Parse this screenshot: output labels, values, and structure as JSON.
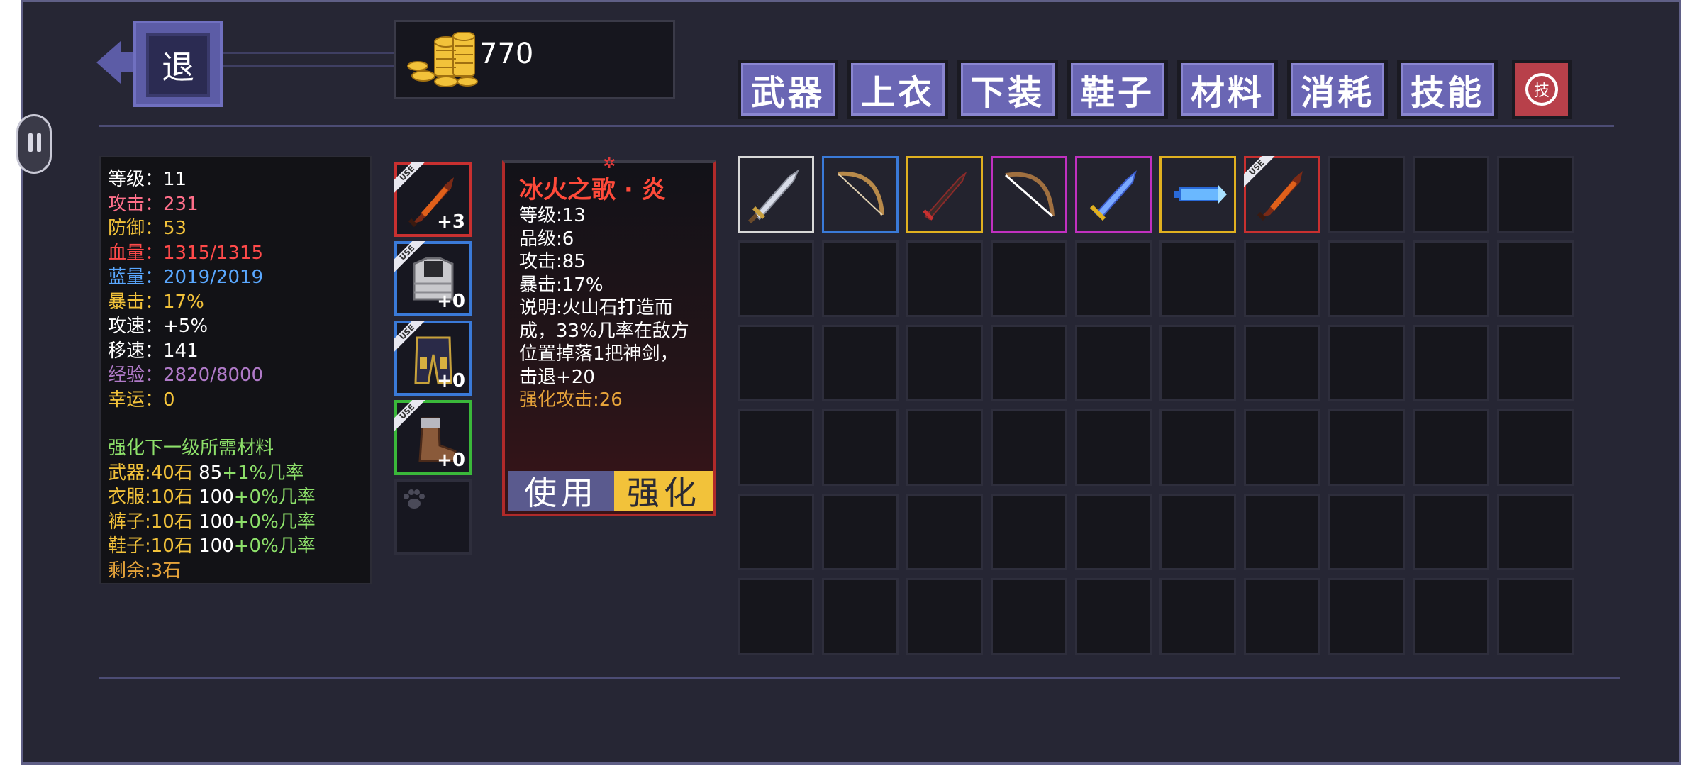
{
  "header": {
    "back_label": "退",
    "gold_value": "770"
  },
  "tabs": [
    "武器",
    "上衣",
    "下装",
    "鞋子",
    "材料",
    "消耗",
    "技能"
  ],
  "skill_tab_label": "技",
  "stats": {
    "level": "等级：11",
    "attack": "攻击：231",
    "defense": "防御：53",
    "hp": "血量：1315/1315",
    "mp": "蓝量：2019/2019",
    "crit": "暴击：17%",
    "atk_speed": "攻速：+5%",
    "move_speed": "移速：141",
    "exp": "经验：2820/8000",
    "luck": "幸运：0"
  },
  "upgrade": {
    "heading": "强化下一级所需材料",
    "weapon_label": "武器:40石",
    "weapon_base": "85",
    "weapon_rate": "+1%几率",
    "clothes_label": "衣服:10石",
    "clothes_base": "100",
    "clothes_rate": "+0%几率",
    "pants_label": "裤子:10石",
    "pants_base": "100",
    "pants_rate": "+0%几率",
    "shoes_label": "鞋子:10石",
    "shoes_base": "100",
    "shoes_rate": "+0%几率",
    "remaining": "剩余:3石"
  },
  "equipment": {
    "weapon_plus": "+3",
    "armor_plus": "+0",
    "pants_plus": "+0",
    "shoes_plus": "+0",
    "use_tag": "USE"
  },
  "detail": {
    "title": "冰火之歌 · 炎",
    "level": "等级:13",
    "quality": "品级:6",
    "attack": "攻击:85",
    "crit": "暴击:17%",
    "desc1": "说明:火山石打造而",
    "desc2": "成，33%几率在敌方",
    "desc3": "位置掉落1把神剑，",
    "desc4": "击退+20",
    "enhance": "强化攻击:26",
    "use_button": "使用",
    "enhance_button": "强化"
  },
  "inventory": [
    {
      "icon": "silver-sword-icon",
      "rarity": "#d8d8d8"
    },
    {
      "icon": "wooden-bow-icon",
      "rarity": "#3a7ad8"
    },
    {
      "icon": "dark-blade-icon",
      "rarity": "#e0b020"
    },
    {
      "icon": "long-bow-icon",
      "rarity": "#c030c0"
    },
    {
      "icon": "ice-sword-icon",
      "rarity": "#c030c0"
    },
    {
      "icon": "ice-blaster-icon",
      "rarity": "#e0b020"
    },
    {
      "icon": "flame-sword-icon",
      "rarity": "#c83030"
    }
  ],
  "colors": {
    "attack": "#ff6f8a",
    "defense": "#f2c23a",
    "hp": "#ff4a4a",
    "mp": "#5aa8ff",
    "crit": "#f2c23a",
    "exp": "#b07ac8",
    "luck": "#f2c23a",
    "green": "#8de06a",
    "yellow": "#f2c23a",
    "orange": "#e6a33a"
  }
}
